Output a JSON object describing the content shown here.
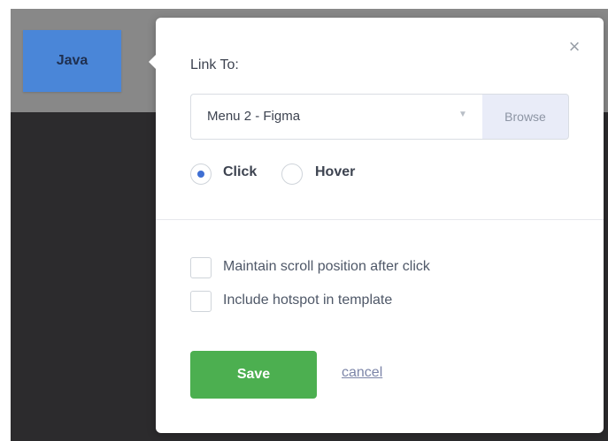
{
  "canvas": {
    "hotspot_label": "Java"
  },
  "popover": {
    "close_icon": "×",
    "link_to_label": "Link To:",
    "select": {
      "value": "Menu 2 - Figma",
      "caret": "▼"
    },
    "browse_label": "Browse",
    "trigger": {
      "options": [
        "Click",
        "Hover"
      ],
      "selected": "Click"
    },
    "options": [
      {
        "label": "Maintain scroll position after click",
        "checked": false
      },
      {
        "label": "Include hotspot in template",
        "checked": false
      }
    ],
    "save_label": "Save",
    "cancel_label": "cancel"
  },
  "colors": {
    "save_green": "#4caf50",
    "hotspot_blue": "#4a86d8",
    "radio_blue": "#3f6fd3"
  }
}
